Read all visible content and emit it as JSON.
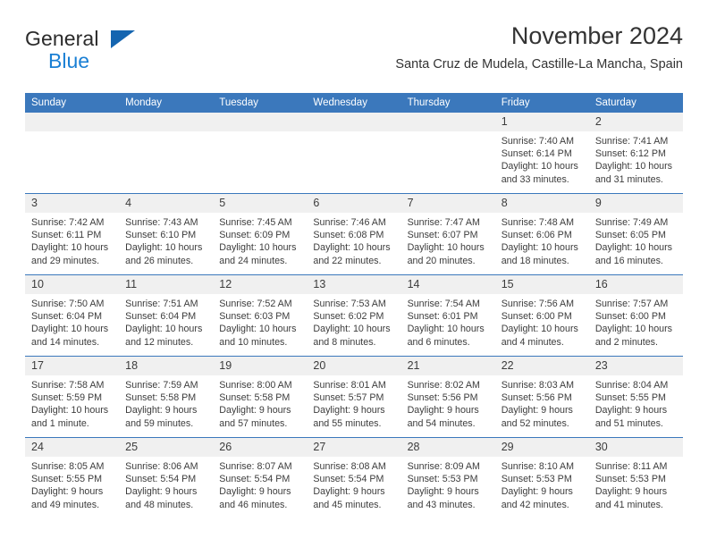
{
  "brand": {
    "name_top": "General",
    "name_bottom": "Blue",
    "triangle_color": "#1565b0",
    "blue_color": "#1a7fd4"
  },
  "header": {
    "title": "November 2024",
    "subtitle": "Santa Cruz de Mudela, Castille-La Mancha, Spain",
    "accent_color": "#3b78bc"
  },
  "calendar": {
    "weekday_headers": [
      "Sunday",
      "Monday",
      "Tuesday",
      "Wednesday",
      "Thursday",
      "Friday",
      "Saturday"
    ],
    "weeks": [
      [
        {
          "day": "",
          "lines": []
        },
        {
          "day": "",
          "lines": []
        },
        {
          "day": "",
          "lines": []
        },
        {
          "day": "",
          "lines": []
        },
        {
          "day": "",
          "lines": []
        },
        {
          "day": "1",
          "lines": [
            "Sunrise: 7:40 AM",
            "Sunset: 6:14 PM",
            "Daylight: 10 hours and 33 minutes."
          ]
        },
        {
          "day": "2",
          "lines": [
            "Sunrise: 7:41 AM",
            "Sunset: 6:12 PM",
            "Daylight: 10 hours and 31 minutes."
          ]
        }
      ],
      [
        {
          "day": "3",
          "lines": [
            "Sunrise: 7:42 AM",
            "Sunset: 6:11 PM",
            "Daylight: 10 hours and 29 minutes."
          ]
        },
        {
          "day": "4",
          "lines": [
            "Sunrise: 7:43 AM",
            "Sunset: 6:10 PM",
            "Daylight: 10 hours and 26 minutes."
          ]
        },
        {
          "day": "5",
          "lines": [
            "Sunrise: 7:45 AM",
            "Sunset: 6:09 PM",
            "Daylight: 10 hours and 24 minutes."
          ]
        },
        {
          "day": "6",
          "lines": [
            "Sunrise: 7:46 AM",
            "Sunset: 6:08 PM",
            "Daylight: 10 hours and 22 minutes."
          ]
        },
        {
          "day": "7",
          "lines": [
            "Sunrise: 7:47 AM",
            "Sunset: 6:07 PM",
            "Daylight: 10 hours and 20 minutes."
          ]
        },
        {
          "day": "8",
          "lines": [
            "Sunrise: 7:48 AM",
            "Sunset: 6:06 PM",
            "Daylight: 10 hours and 18 minutes."
          ]
        },
        {
          "day": "9",
          "lines": [
            "Sunrise: 7:49 AM",
            "Sunset: 6:05 PM",
            "Daylight: 10 hours and 16 minutes."
          ]
        }
      ],
      [
        {
          "day": "10",
          "lines": [
            "Sunrise: 7:50 AM",
            "Sunset: 6:04 PM",
            "Daylight: 10 hours and 14 minutes."
          ]
        },
        {
          "day": "11",
          "lines": [
            "Sunrise: 7:51 AM",
            "Sunset: 6:04 PM",
            "Daylight: 10 hours and 12 minutes."
          ]
        },
        {
          "day": "12",
          "lines": [
            "Sunrise: 7:52 AM",
            "Sunset: 6:03 PM",
            "Daylight: 10 hours and 10 minutes."
          ]
        },
        {
          "day": "13",
          "lines": [
            "Sunrise: 7:53 AM",
            "Sunset: 6:02 PM",
            "Daylight: 10 hours and 8 minutes."
          ]
        },
        {
          "day": "14",
          "lines": [
            "Sunrise: 7:54 AM",
            "Sunset: 6:01 PM",
            "Daylight: 10 hours and 6 minutes."
          ]
        },
        {
          "day": "15",
          "lines": [
            "Sunrise: 7:56 AM",
            "Sunset: 6:00 PM",
            "Daylight: 10 hours and 4 minutes."
          ]
        },
        {
          "day": "16",
          "lines": [
            "Sunrise: 7:57 AM",
            "Sunset: 6:00 PM",
            "Daylight: 10 hours and 2 minutes."
          ]
        }
      ],
      [
        {
          "day": "17",
          "lines": [
            "Sunrise: 7:58 AM",
            "Sunset: 5:59 PM",
            "Daylight: 10 hours and 1 minute."
          ]
        },
        {
          "day": "18",
          "lines": [
            "Sunrise: 7:59 AM",
            "Sunset: 5:58 PM",
            "Daylight: 9 hours and 59 minutes."
          ]
        },
        {
          "day": "19",
          "lines": [
            "Sunrise: 8:00 AM",
            "Sunset: 5:58 PM",
            "Daylight: 9 hours and 57 minutes."
          ]
        },
        {
          "day": "20",
          "lines": [
            "Sunrise: 8:01 AM",
            "Sunset: 5:57 PM",
            "Daylight: 9 hours and 55 minutes."
          ]
        },
        {
          "day": "21",
          "lines": [
            "Sunrise: 8:02 AM",
            "Sunset: 5:56 PM",
            "Daylight: 9 hours and 54 minutes."
          ]
        },
        {
          "day": "22",
          "lines": [
            "Sunrise: 8:03 AM",
            "Sunset: 5:56 PM",
            "Daylight: 9 hours and 52 minutes."
          ]
        },
        {
          "day": "23",
          "lines": [
            "Sunrise: 8:04 AM",
            "Sunset: 5:55 PM",
            "Daylight: 9 hours and 51 minutes."
          ]
        }
      ],
      [
        {
          "day": "24",
          "lines": [
            "Sunrise: 8:05 AM",
            "Sunset: 5:55 PM",
            "Daylight: 9 hours and 49 minutes."
          ]
        },
        {
          "day": "25",
          "lines": [
            "Sunrise: 8:06 AM",
            "Sunset: 5:54 PM",
            "Daylight: 9 hours and 48 minutes."
          ]
        },
        {
          "day": "26",
          "lines": [
            "Sunrise: 8:07 AM",
            "Sunset: 5:54 PM",
            "Daylight: 9 hours and 46 minutes."
          ]
        },
        {
          "day": "27",
          "lines": [
            "Sunrise: 8:08 AM",
            "Sunset: 5:54 PM",
            "Daylight: 9 hours and 45 minutes."
          ]
        },
        {
          "day": "28",
          "lines": [
            "Sunrise: 8:09 AM",
            "Sunset: 5:53 PM",
            "Daylight: 9 hours and 43 minutes."
          ]
        },
        {
          "day": "29",
          "lines": [
            "Sunrise: 8:10 AM",
            "Sunset: 5:53 PM",
            "Daylight: 9 hours and 42 minutes."
          ]
        },
        {
          "day": "30",
          "lines": [
            "Sunrise: 8:11 AM",
            "Sunset: 5:53 PM",
            "Daylight: 9 hours and 41 minutes."
          ]
        }
      ]
    ]
  }
}
